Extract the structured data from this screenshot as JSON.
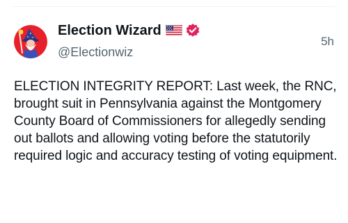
{
  "post": {
    "author": {
      "display_name": "Election Wizard",
      "handle": "@Electionwiz",
      "flag_icon": "us-flag-icon",
      "verified_icon": "verified-badge-icon",
      "verified_color": "#e0245e",
      "avatar_icon": "wizard-avatar-icon",
      "avatar_bg_color": "#e8202a"
    },
    "timestamp": "5h",
    "text": "ELECTION INTEGRITY REPORT: Last week, the RNC, brought suit in Pennsylvania against the Montgomery County Board of Commissioners for allegedly sending out ballots and allowing voting before the statutorily required logic and accuracy testing of voting equipment."
  }
}
